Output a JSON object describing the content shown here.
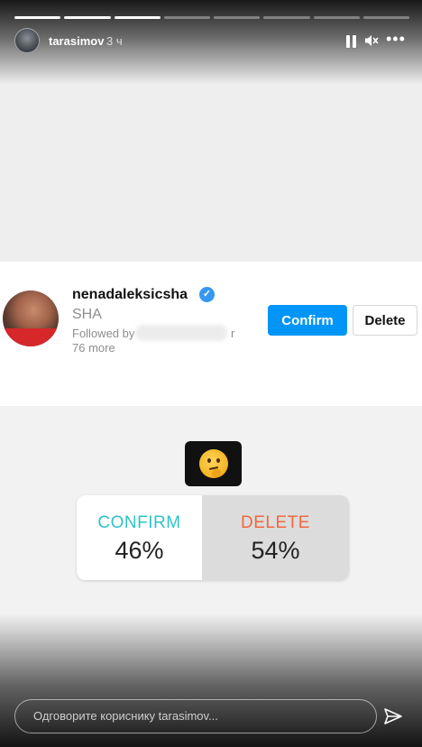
{
  "story": {
    "progress": {
      "total_segments": 8,
      "completed_segments": 3
    },
    "header": {
      "username": "tarasimov",
      "time": "3 ч"
    },
    "request_card": {
      "name": "nenadaleksicsha",
      "subtitle": "SHA",
      "followed_by": "Followed by",
      "followed_suffix": "r",
      "more": "76 more",
      "confirm_label": "Confirm",
      "delete_label": "Delete"
    },
    "poll": {
      "options": [
        {
          "label": "CONFIRM",
          "percent": "46%",
          "color": "#2fc3c9"
        },
        {
          "label": "DELETE",
          "percent": "54%",
          "color": "#f0683f"
        }
      ]
    },
    "reply": {
      "placeholder": "Одговорите кориснику tarasimov..."
    }
  },
  "colors": {
    "accent": "#0095f6",
    "verified": "#3797f0"
  }
}
